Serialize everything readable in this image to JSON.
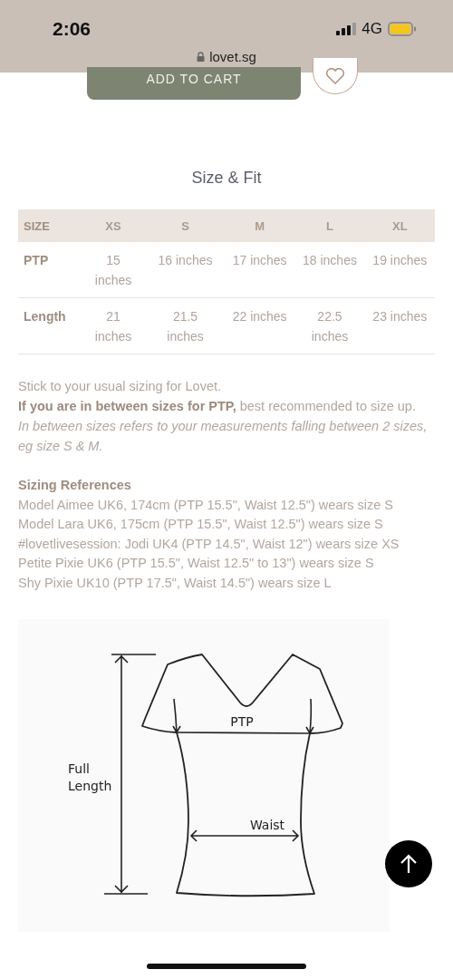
{
  "status_bar": {
    "time": "2:06",
    "network": "4G"
  },
  "address_bar": {
    "url": "lovet.sg"
  },
  "add_to_cart": {
    "label": "ADD TO CART"
  },
  "section_title": "Size & Fit",
  "size_table": {
    "columns": [
      "SIZE",
      "XS",
      "S",
      "M",
      "L",
      "XL"
    ],
    "rows": [
      {
        "cells": [
          "PTP",
          "15 inches",
          "16 inches",
          "17 inches",
          "18 inches",
          "19 inches"
        ]
      },
      {
        "cells": [
          "Length",
          "21 inches",
          "21.5 inches",
          "22 inches",
          "22.5 inches",
          "23 inches"
        ]
      }
    ]
  },
  "notes": [
    {
      "kind": "plain",
      "text": "Stick to your usual sizing for Lovet."
    },
    {
      "kind": "plain",
      "text": "**If you are in between sizes for PTP,** best recommended to size up."
    },
    {
      "kind": "italic",
      "text": "In between sizes refers to your measurements falling between 2 sizes, eg size S & M."
    }
  ],
  "references": {
    "title": "Sizing References",
    "lines": [
      "Model Aimee UK6, 174cm (PTP 15.5\", Waist 12.5\") wears size S",
      "Model Lara UK6, 175cm (PTP 15.5\", Waist 12.5\") wears size S",
      "#lovetlivesession: Jodi UK4 (PTP 14.5\", Waist 12\") wears size XS",
      "Petite Pixie UK6 (PTP 15.5\", Waist 12.5\" to 13\") wears size S",
      "Shy Pixie UK10 (PTP 17.5\", Waist 14.5\") wears size L"
    ]
  },
  "diagram": {
    "ptp_label": "PTP",
    "waist_label": "Waist",
    "length_label": "Full Length"
  }
}
